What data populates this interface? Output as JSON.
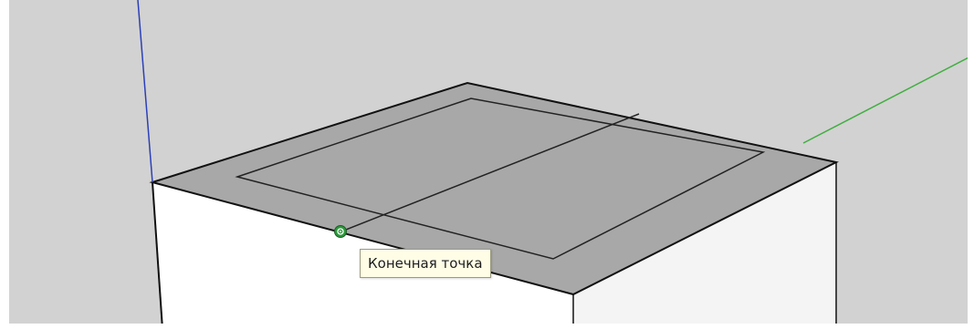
{
  "viewport": {
    "background_color": "#d2d2d2",
    "tooltip_text": "Конечная точка",
    "inference_type": "endpoint",
    "axis_colors": {
      "blue_axis": "#2b3fb8",
      "green_axis": "#3fae3f"
    },
    "face_colors": {
      "top_face": "#a8a8a8",
      "front_face": "#ffffff",
      "side_face": "#f4f4f4"
    },
    "inference_point_color": "#2e9a3c"
  }
}
